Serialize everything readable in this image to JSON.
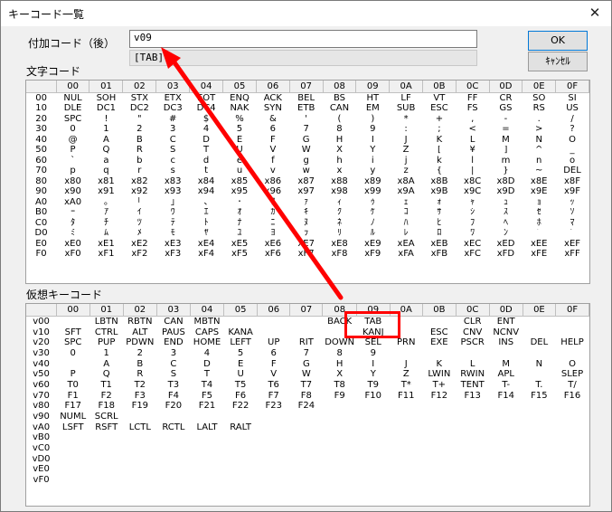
{
  "window": {
    "title": "キーコード一覧",
    "close_glyph": "✕"
  },
  "labels": {
    "additional_code": "付加コード（後）",
    "char_code": "文字コード",
    "virtual_key_code": "仮想キーコード"
  },
  "additional_code_value": "v09",
  "selected_display": "[TAB]",
  "buttons": {
    "ok": "OK",
    "cancel": "ｷｬﾝｾﾙ"
  },
  "highlight_color": "#ff0000",
  "columns": [
    "00",
    "01",
    "02",
    "03",
    "04",
    "05",
    "06",
    "07",
    "08",
    "09",
    "0A",
    "0B",
    "0C",
    "0D",
    "0E",
    "0F"
  ],
  "char_rows": [
    {
      "h": "00",
      "c": [
        "NUL",
        "SOH",
        "STX",
        "ETX",
        "EOT",
        "ENQ",
        "ACK",
        "BEL",
        "BS",
        "HT",
        "LF",
        "VT",
        "FF",
        "CR",
        "SO",
        "SI"
      ]
    },
    {
      "h": "10",
      "c": [
        "DLE",
        "DC1",
        "DC2",
        "DC3",
        "DC4",
        "NAK",
        "SYN",
        "ETB",
        "CAN",
        "EM",
        "SUB",
        "ESC",
        "FS",
        "GS",
        "RS",
        "US"
      ]
    },
    {
      "h": "20",
      "c": [
        "SPC",
        "!",
        "\"",
        "#",
        "$",
        "%",
        "&",
        "'",
        "(",
        ")",
        "*",
        "+",
        ",",
        "-",
        ".",
        "/"
      ]
    },
    {
      "h": "30",
      "c": [
        "0",
        "1",
        "2",
        "3",
        "4",
        "5",
        "6",
        "7",
        "8",
        "9",
        ":",
        ";",
        "<",
        "=",
        ">",
        "?"
      ]
    },
    {
      "h": "40",
      "c": [
        "@",
        "A",
        "B",
        "C",
        "D",
        "E",
        "F",
        "G",
        "H",
        "I",
        "J",
        "K",
        "L",
        "M",
        "N",
        "O"
      ]
    },
    {
      "h": "50",
      "c": [
        "P",
        "Q",
        "R",
        "S",
        "T",
        "U",
        "V",
        "W",
        "X",
        "Y",
        "Z",
        "[",
        "¥",
        "]",
        "^",
        "_"
      ]
    },
    {
      "h": "60",
      "c": [
        "`",
        "a",
        "b",
        "c",
        "d",
        "e",
        "f",
        "g",
        "h",
        "i",
        "j",
        "k",
        "l",
        "m",
        "n",
        "o"
      ]
    },
    {
      "h": "70",
      "c": [
        "p",
        "q",
        "r",
        "s",
        "t",
        "u",
        "v",
        "w",
        "x",
        "y",
        "z",
        "{",
        "|",
        "}",
        "~",
        "DEL"
      ]
    },
    {
      "h": "80",
      "c": [
        "x80",
        "x81",
        "x82",
        "x83",
        "x84",
        "x85",
        "x86",
        "x87",
        "x88",
        "x89",
        "x8A",
        "x8B",
        "x8C",
        "x8D",
        "x8E",
        "x8F"
      ]
    },
    {
      "h": "90",
      "c": [
        "x90",
        "x91",
        "x92",
        "x93",
        "x94",
        "x95",
        "x96",
        "x97",
        "x98",
        "x99",
        "x9A",
        "x9B",
        "x9C",
        "x9D",
        "x9E",
        "x9F"
      ]
    },
    {
      "h": "A0",
      "c": [
        "xA0",
        "｡",
        "｢",
        "｣",
        "､",
        "･",
        "ｦ",
        "ｧ",
        "ｨ",
        "ｩ",
        "ｪ",
        "ｫ",
        "ｬ",
        "ｭ",
        "ｮ",
        "ｯ"
      ]
    },
    {
      "h": "B0",
      "c": [
        "ｰ",
        "ｱ",
        "ｲ",
        "ｳ",
        "ｴ",
        "ｵ",
        "ｶ",
        "ｷ",
        "ｸ",
        "ｹ",
        "ｺ",
        "ｻ",
        "ｼ",
        "ｽ",
        "ｾ",
        "ｿ"
      ]
    },
    {
      "h": "C0",
      "c": [
        "ﾀ",
        "ﾁ",
        "ﾂ",
        "ﾃ",
        "ﾄ",
        "ﾅ",
        "ﾆ",
        "ﾇ",
        "ﾈ",
        "ﾉ",
        "ﾊ",
        "ﾋ",
        "ﾌ",
        "ﾍ",
        "ﾎ",
        "ﾏ"
      ]
    },
    {
      "h": "D0",
      "c": [
        "ﾐ",
        "ﾑ",
        "ﾒ",
        "ﾓ",
        "ﾔ",
        "ﾕ",
        "ﾖ",
        "ﾗ",
        "ﾘ",
        "ﾙ",
        "ﾚ",
        "ﾛ",
        "ﾜ",
        "ﾝ",
        "ﾞ",
        "ﾟ"
      ]
    },
    {
      "h": "E0",
      "c": [
        "xE0",
        "xE1",
        "xE2",
        "xE3",
        "xE4",
        "xE5",
        "xE6",
        "xE7",
        "xE8",
        "xE9",
        "xEA",
        "xEB",
        "xEC",
        "xED",
        "xEE",
        "xEF"
      ]
    },
    {
      "h": "F0",
      "c": [
        "xF0",
        "xF1",
        "xF2",
        "xF3",
        "xF4",
        "xF5",
        "xF6",
        "xF7",
        "xF8",
        "xF9",
        "xFA",
        "xFB",
        "xFC",
        "xFD",
        "xFE",
        "xFF"
      ]
    }
  ],
  "vkey_rows": [
    {
      "h": "v00",
      "c": [
        "",
        "LBTN",
        "RBTN",
        "CAN",
        "MBTN",
        "",
        "",
        "",
        "BACK",
        "TAB",
        "",
        "",
        "CLR",
        "ENT",
        "",
        ""
      ]
    },
    {
      "h": "v10",
      "c": [
        "SFT",
        "CTRL",
        "ALT",
        "PAUS",
        "CAPS",
        "KANA",
        "",
        "",
        "",
        "KANJ",
        "",
        "ESC",
        "CNV",
        "NCNV",
        "",
        ""
      ]
    },
    {
      "h": "v20",
      "c": [
        "SPC",
        "PUP",
        "PDWN",
        "END",
        "HOME",
        "LEFT",
        "UP",
        "RIT",
        "DOWN",
        "SEL",
        "PRN",
        "EXE",
        "PSCR",
        "INS",
        "DEL",
        "HELP"
      ]
    },
    {
      "h": "v30",
      "c": [
        "0",
        "1",
        "2",
        "3",
        "4",
        "5",
        "6",
        "7",
        "8",
        "9",
        "",
        "",
        "",
        "",
        "",
        ""
      ]
    },
    {
      "h": "v40",
      "c": [
        "",
        "A",
        "B",
        "C",
        "D",
        "E",
        "F",
        "G",
        "H",
        "I",
        "J",
        "K",
        "L",
        "M",
        "N",
        "O"
      ]
    },
    {
      "h": "v50",
      "c": [
        "P",
        "Q",
        "R",
        "S",
        "T",
        "U",
        "V",
        "W",
        "X",
        "Y",
        "Z",
        "LWIN",
        "RWIN",
        "APL",
        "",
        "SLEP"
      ]
    },
    {
      "h": "v60",
      "c": [
        "T0",
        "T1",
        "T2",
        "T3",
        "T4",
        "T5",
        "T6",
        "T7",
        "T8",
        "T9",
        "T*",
        "T+",
        "TENT",
        "T-",
        "T.",
        "T/"
      ]
    },
    {
      "h": "v70",
      "c": [
        "F1",
        "F2",
        "F3",
        "F4",
        "F5",
        "F6",
        "F7",
        "F8",
        "F9",
        "F10",
        "F11",
        "F12",
        "F13",
        "F14",
        "F15",
        "F16"
      ]
    },
    {
      "h": "v80",
      "c": [
        "F17",
        "F18",
        "F19",
        "F20",
        "F21",
        "F22",
        "F23",
        "F24",
        "",
        "",
        "",
        "",
        "",
        "",
        "",
        ""
      ]
    },
    {
      "h": "v90",
      "c": [
        "NUML",
        "SCRL",
        "",
        "",
        "",
        "",
        "",
        "",
        "",
        "",
        "",
        "",
        "",
        "",
        "",
        ""
      ]
    },
    {
      "h": "vA0",
      "c": [
        "LSFT",
        "RSFT",
        "LCTL",
        "RCTL",
        "LALT",
        "RALT",
        "",
        "",
        "",
        "",
        "",
        "",
        "",
        "",
        "",
        ""
      ]
    },
    {
      "h": "vB0",
      "c": [
        "",
        "",
        "",
        "",
        "",
        "",
        "",
        "",
        "",
        "",
        "",
        "",
        "",
        "",
        "",
        ""
      ]
    },
    {
      "h": "vC0",
      "c": [
        "",
        "",
        "",
        "",
        "",
        "",
        "",
        "",
        "",
        "",
        "",
        "",
        "",
        "",
        "",
        ""
      ]
    },
    {
      "h": "vD0",
      "c": [
        "",
        "",
        "",
        "",
        "",
        "",
        "",
        "",
        "",
        "",
        "",
        "",
        "",
        "",
        "",
        ""
      ]
    },
    {
      "h": "vE0",
      "c": [
        "",
        "",
        "",
        "",
        "",
        "",
        "",
        "",
        "",
        "",
        "",
        "",
        "",
        "",
        "",
        ""
      ]
    },
    {
      "h": "vF0",
      "c": [
        "",
        "",
        "",
        "",
        "",
        "",
        "",
        "",
        "",
        "",
        "",
        "",
        "",
        "",
        "",
        ""
      ]
    }
  ]
}
